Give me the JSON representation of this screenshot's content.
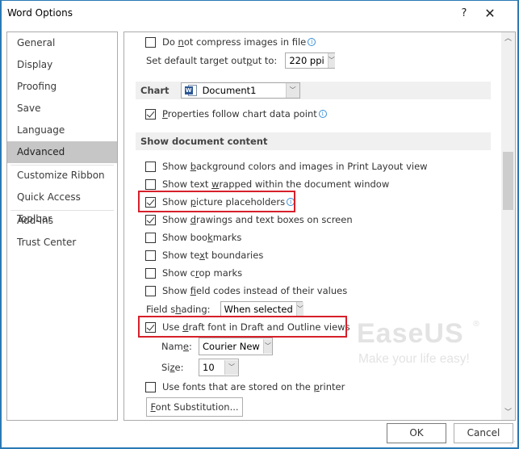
{
  "window": {
    "title": "Word Options",
    "help_label": "?",
    "close_label": "✕"
  },
  "sidebar": {
    "items": [
      {
        "label": "General"
      },
      {
        "label": "Display"
      },
      {
        "label": "Proofing"
      },
      {
        "label": "Save"
      },
      {
        "label": "Language"
      },
      {
        "label": "Advanced",
        "active": true
      },
      {
        "label": "Customize Ribbon"
      },
      {
        "label": "Quick Access Toolbar"
      },
      {
        "label": "Add-Ins"
      },
      {
        "label": "Trust Center"
      }
    ]
  },
  "content": {
    "image_size": {
      "do_not_compress": {
        "pre": "Do ",
        "ul": "n",
        "post": "ot compress images in file",
        "checked": false
      },
      "target_output_label": {
        "pre": "Set default target out",
        "ul": "p",
        "post": "ut to:"
      },
      "target_output_value": "220 ppi"
    },
    "chart": {
      "header": "Chart",
      "document_value": "Document1",
      "properties_follow": {
        "pre": "",
        "ul": "P",
        "post": "roperties follow chart data point",
        "checked": true
      }
    },
    "show_document_content": {
      "header": "Show document content",
      "options": [
        {
          "pre": "Show ",
          "ul": "b",
          "post": "ackground colors and images in Print Layout view",
          "checked": false
        },
        {
          "pre": "Show text ",
          "ul": "w",
          "post": "rapped within the document window",
          "checked": false
        },
        {
          "pre": "Show ",
          "ul": "p",
          "post": "icture placeholders",
          "checked": true,
          "info": true
        },
        {
          "pre": "Show ",
          "ul": "d",
          "post": "rawings and text boxes on screen",
          "checked": true
        },
        {
          "pre": "Show boo",
          "ul": "k",
          "post": "marks",
          "checked": false
        },
        {
          "pre": "Show te",
          "ul": "x",
          "post": "t boundaries",
          "checked": false
        },
        {
          "pre": "Show c",
          "ul": "r",
          "post": "op marks",
          "checked": false
        },
        {
          "pre": "Show ",
          "ul": "f",
          "post": "ield codes instead of their values",
          "checked": false
        }
      ],
      "field_shading_label": {
        "pre": "Field s",
        "ul": "h",
        "post": "ading:"
      },
      "field_shading_value": "When selected",
      "draft_font": {
        "pre": "Use ",
        "ul": "d",
        "post": "raft font in Draft and Outline views",
        "checked": true
      },
      "name_label": {
        "pre": "Nam",
        "ul": "e",
        "post": ":"
      },
      "name_value": "Courier New",
      "size_label": {
        "pre": "Si",
        "ul": "z",
        "post": "e:"
      },
      "size_value": "10",
      "printer_fonts": {
        "pre": "Use fonts that are stored on the ",
        "ul": "p",
        "post": "rinter",
        "checked": false
      },
      "font_substitution": {
        "pre": "",
        "ul": "F",
        "post": "ont Substitution..."
      }
    }
  },
  "watermark": {
    "brand": "EaseUS",
    "reg": "®",
    "tagline": "Make your life easy!"
  },
  "footer": {
    "ok_label": "OK",
    "cancel_label": "Cancel"
  },
  "colors": {
    "highlight": "#d6202a",
    "window_border": "#2b79b5",
    "active_nav": "#c6c6c6"
  }
}
